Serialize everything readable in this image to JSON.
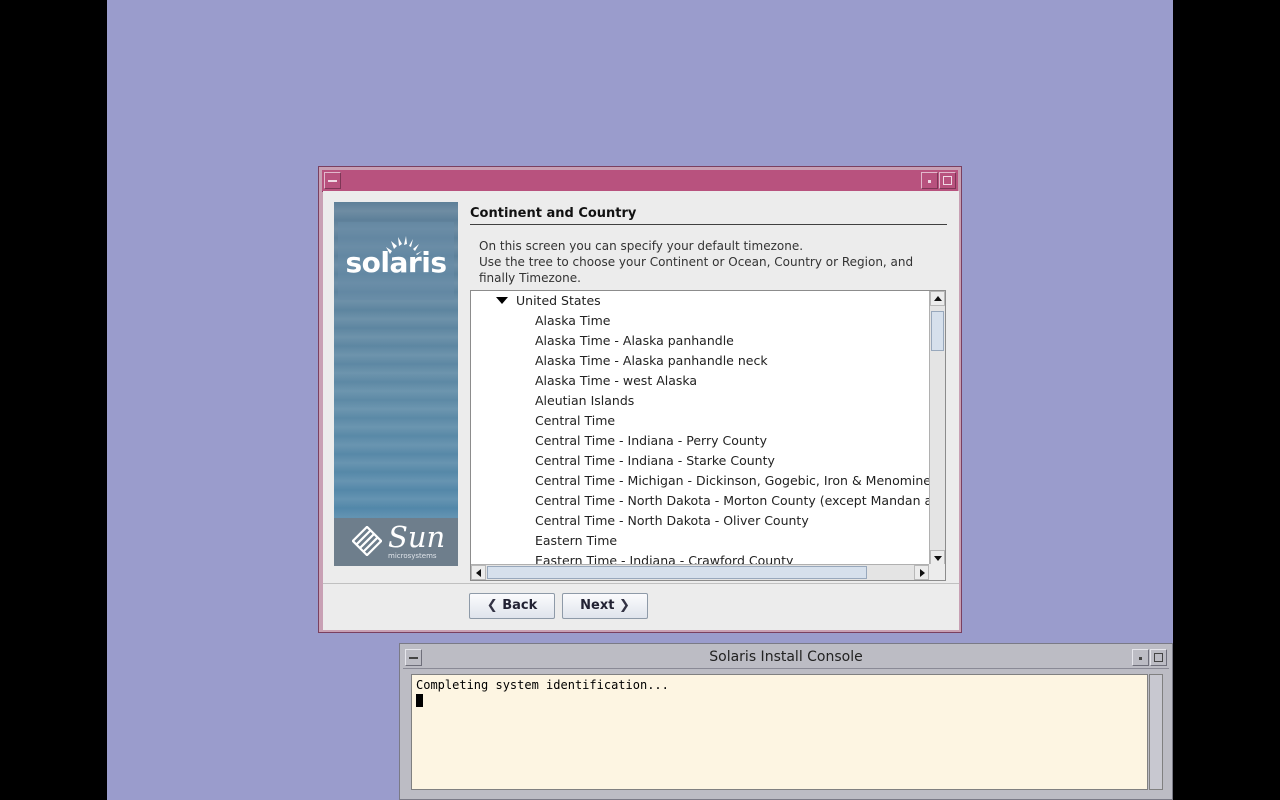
{
  "installer": {
    "heading": "Continent and Country",
    "description": [
      "On this screen you can specify your default timezone.",
      "Use the tree to choose your Continent or Ocean, Country or Region, and",
      "finally Timezone."
    ],
    "sidebar": {
      "product_logo": "solaris",
      "vendor_logo": "Sun",
      "vendor_sub": "microsystems"
    },
    "tree": {
      "country": "United States",
      "timezones": [
        "Alaska Time",
        "Alaska Time - Alaska panhandle",
        "Alaska Time - Alaska panhandle neck",
        "Alaska Time - west Alaska",
        "Aleutian Islands",
        "Central Time",
        "Central Time - Indiana - Perry County",
        "Central Time - Indiana - Starke County",
        "Central Time - Michigan - Dickinson, Gogebic, Iron & Menominee Counties",
        "Central Time - North Dakota - Morton County (except Mandan area)",
        "Central Time - North Dakota - Oliver County",
        "Eastern Time",
        "Eastern Time - Indiana - Crawford County"
      ]
    },
    "buttons": {
      "back": "Back",
      "next": "Next"
    }
  },
  "console": {
    "title": "Solaris Install Console",
    "output": "Completing system identification..."
  },
  "colors": {
    "desktop": "#9a9ccc",
    "installer_titlebar": "#b8527e",
    "console_background": "#fdf5e2"
  }
}
